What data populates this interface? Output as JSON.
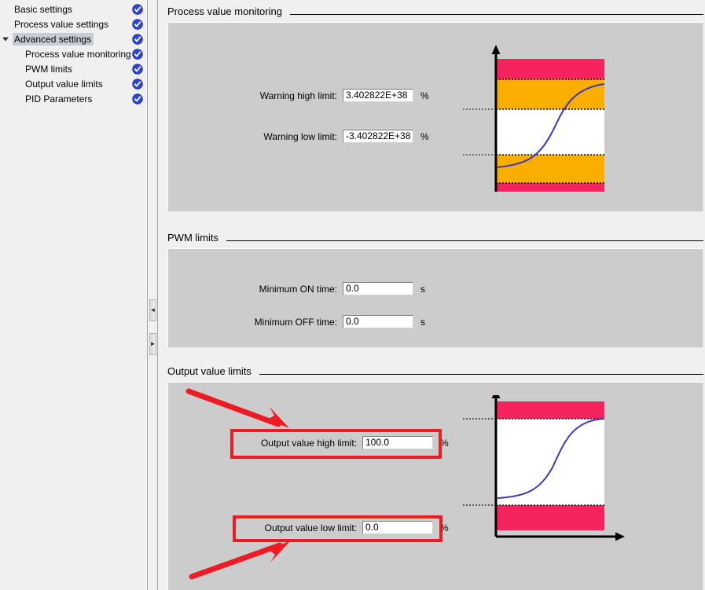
{
  "sidebar": {
    "items": [
      {
        "label": "Basic settings",
        "level": 1,
        "selected": false,
        "expander": false,
        "check": true
      },
      {
        "label": "Process value settings",
        "level": 1,
        "selected": false,
        "expander": false,
        "check": true
      },
      {
        "label": "Advanced settings",
        "level": 1,
        "selected": true,
        "expander": true,
        "check": true
      },
      {
        "label": "Process value monitoring",
        "level": 2,
        "selected": false,
        "expander": false,
        "check": true
      },
      {
        "label": "PWM limits",
        "level": 2,
        "selected": false,
        "expander": false,
        "check": true
      },
      {
        "label": "Output value limits",
        "level": 2,
        "selected": false,
        "expander": false,
        "check": true
      },
      {
        "label": "PID Parameters",
        "level": 2,
        "selected": false,
        "expander": false,
        "check": true
      }
    ]
  },
  "splitter": {
    "collapse_left_icon": "◄",
    "collapse_right_icon": "►"
  },
  "sections": {
    "process_value_monitoring": {
      "title": "Process value monitoring",
      "fields": [
        {
          "label": "Warning high limit:",
          "value": "3.402822E+38",
          "unit": "%"
        },
        {
          "label": "Warning low limit:",
          "value": "-3.402822E+38",
          "unit": "%"
        }
      ]
    },
    "pwm_limits": {
      "title": "PWM limits",
      "fields": [
        {
          "label": "Minimum ON time:",
          "value": "0.0",
          "unit": "s"
        },
        {
          "label": "Minimum OFF time:",
          "value": "0.0",
          "unit": "s"
        }
      ]
    },
    "output_value_limits": {
      "title": "Output value limits",
      "fields": [
        {
          "label": "Output value high limit:",
          "value": "100.0",
          "unit": "%",
          "highlighted": true
        },
        {
          "label": "Output value low limit:",
          "value": "0.0",
          "unit": "%",
          "highlighted": true
        }
      ]
    }
  },
  "colors": {
    "alarm_band": "#f5245f",
    "warning_band": "#faaf00",
    "normal_band": "#ffffff",
    "curve": "#3a37c8",
    "annotation": "#ed1c24",
    "panel_bg": "#cccccc",
    "page_bg": "#f0f0f0",
    "check_badge": "#2c44d8",
    "selection": "#c8cdd4"
  },
  "diagrams": {
    "process_value": {
      "name": "process-value-limits-diagram",
      "bands": [
        {
          "name": "high-alarm",
          "color": "#f5245f"
        },
        {
          "name": "high-warning",
          "color": "#faaf00"
        },
        {
          "name": "normal",
          "color": "#ffffff"
        },
        {
          "name": "low-warning",
          "color": "#faaf00"
        },
        {
          "name": "low-alarm",
          "color": "#f5245f"
        }
      ],
      "marker_lines": 2,
      "curve": "s-curve"
    },
    "output_value": {
      "name": "output-value-limits-diagram",
      "bands": [
        {
          "name": "above-high-limit",
          "color": "#f5245f"
        },
        {
          "name": "within-limits",
          "color": "#ffffff"
        },
        {
          "name": "below-low-limit",
          "color": "#f5245f"
        }
      ],
      "marker_lines": 2,
      "curve": "s-curve"
    }
  }
}
